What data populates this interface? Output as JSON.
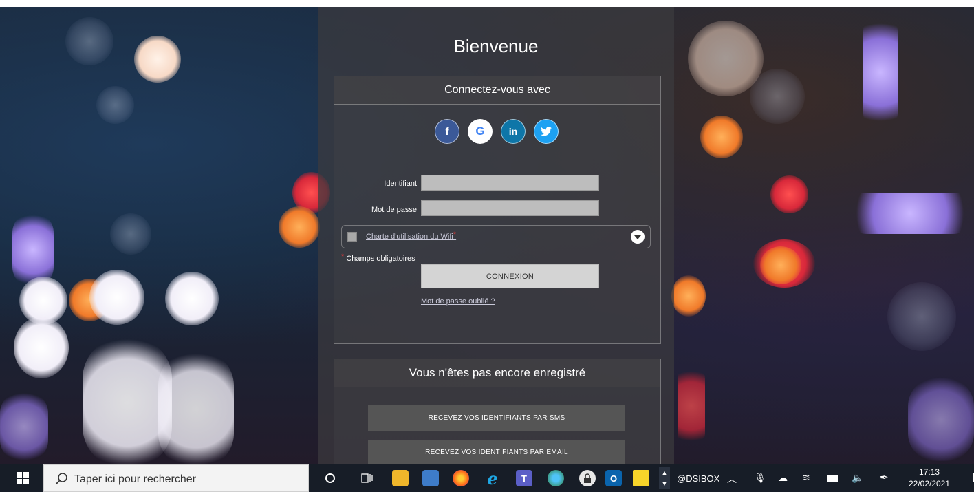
{
  "page": {
    "title": "Bienvenue"
  },
  "login": {
    "header": "Connectez-vous avec",
    "socials": [
      {
        "name": "facebook-icon",
        "glyph": "f",
        "color": "#3b5998"
      },
      {
        "name": "google-icon",
        "glyph": "G",
        "color": "#ffffff"
      },
      {
        "name": "linkedin-icon",
        "glyph": "in",
        "color": "#0e76a8"
      },
      {
        "name": "twitter-icon",
        "glyph": "🐦",
        "color": "#1da1f2"
      }
    ],
    "identifier_label": "Identifiant",
    "identifier_value": "",
    "password_label": "Mot de passe",
    "password_value": "",
    "charter_link": "Charte d'utilisation du Wifi",
    "required_star": "*",
    "required_note": "Champs obligatoires",
    "connect_button": "CONNEXION",
    "forgot_link": "Mot de passe oublié ?"
  },
  "register": {
    "header": "Vous n'êtes pas encore enregistré",
    "sms_button": "RECEVEZ VOS IDENTIFIANTS PAR SMS",
    "email_button": "RECEVEZ VOS IDENTIFIANTS PAR EMAIL"
  },
  "taskbar": {
    "search_placeholder": "Taper ici pour rechercher",
    "tray_label": "@DSIBOX",
    "time": "17:13",
    "date": "22/02/2021"
  },
  "colors": {
    "panel": "#3c3a3e",
    "accent_button": "#d4d4d4",
    "register_button": "#555555",
    "taskbar": "#171d27"
  }
}
